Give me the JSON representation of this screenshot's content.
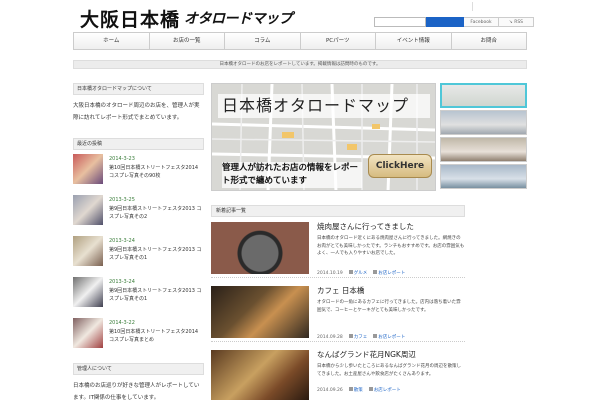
{
  "header": {
    "logo_main": "大阪日本橋",
    "logo_sub": "オタロードマップ",
    "top_links": [
      "",
      ""
    ],
    "search_placeholder": "",
    "social": [
      {
        "label": "Facebook"
      },
      {
        "label": "RSS"
      }
    ]
  },
  "nav": [
    {
      "label": "ホーム"
    },
    {
      "label": "お店の一覧"
    },
    {
      "label": "コラム"
    },
    {
      "label": "PCパーツ"
    },
    {
      "label": "イベント情報"
    },
    {
      "label": "お問合"
    }
  ],
  "notice": "日本橋オタロードのお店をレポートしています。掲載情報は訪問時のものです。",
  "sidebar": {
    "about_title": "日本橋オタロードマップについて",
    "about_text": "大阪日本橋のオタロード周辺のお店を、管理人が実際に訪れてレポート形式でまとめています。",
    "recent_title": "最近の投稿",
    "posts": [
      {
        "date": "2014-3-23",
        "title": "第10回日本橋ストリートフェスタ2014 コスプレ写真その90枚"
      },
      {
        "date": "2013-3-25",
        "title": "第9回日本橋ストリートフェスタ2013 コスプレ写真その2"
      },
      {
        "date": "2013-3-24",
        "title": "第9回日本橋ストリートフェスタ2013 コスプレ写真その1"
      },
      {
        "date": "2013-3-24",
        "title": "第9回日本橋ストリートフェスタ2013 コスプレ写真その1"
      },
      {
        "date": "2014-3-22",
        "title": "第10回日本橋ストリートフェスタ2014 コスプレ写真まとめ"
      }
    ],
    "profile_title": "管理人について",
    "profile_text": "日本橋のお店巡りが好きな管理人がレポートしています。IT関係の仕事をしています。"
  },
  "banner": {
    "title": "日本橋オタロードマップ",
    "copy": "管理人が訪れたお店の情報をレポート形式で纏めています",
    "button": "ClickHere"
  },
  "articles_title": "新着記事一覧",
  "articles": [
    {
      "title": "焼肉屋さんに行ってきました",
      "text": "日本橋のオタロード近くにある焼肉屋さんに行ってきました。網焼きのお肉がとても美味しかったです。ランチもおすすめです。お店の雰囲気もよく、一人でも入りやすいお店でした。",
      "date": "2014.10.19",
      "cat": "グルメ",
      "tag": "お店レポート"
    },
    {
      "title": "カフェ 日本橋",
      "text": "オタロードの一角にあるカフェに行ってきました。店内は落ち着いた雰囲気で、コーヒーとケーキがとても美味しかったです。",
      "date": "2014.09.28",
      "cat": "カフェ",
      "tag": "お店レポート"
    },
    {
      "title": "なんばグランド花月NGK周辺",
      "text": "日本橋から少し歩いたところにあるなんばグランド花月の周辺を散策してきました。お土産屋さんや飲食店がたくさんあります。",
      "date": "2014.09.26",
      "cat": "散策",
      "tag": "お店レポート"
    }
  ],
  "colors": {
    "accent": "#1b63c6",
    "date_green": "#3a7d3a",
    "thumb_highlight": "#4fc7d8"
  }
}
